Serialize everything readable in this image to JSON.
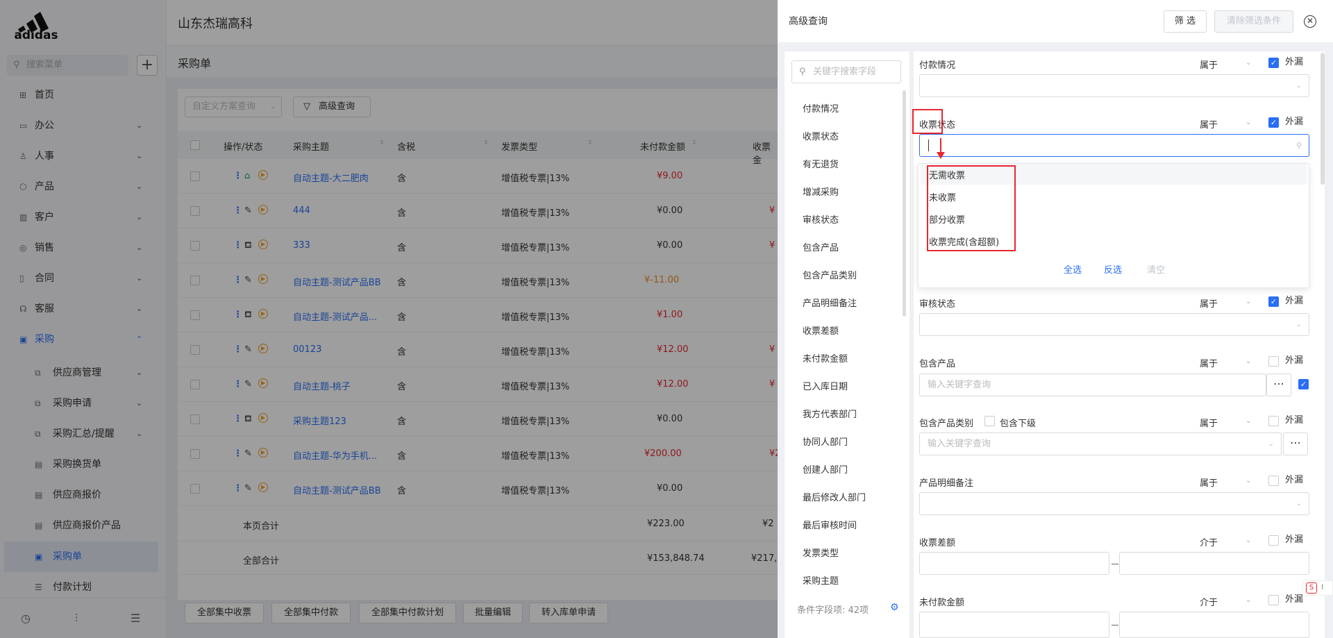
{
  "sidebar": {
    "brand": "adidas",
    "search_placeholder": "搜索菜单",
    "menu": [
      {
        "label": "首页",
        "icon": "home-icon"
      },
      {
        "label": "办公",
        "icon": "office-icon"
      },
      {
        "label": "人事",
        "icon": "people-icon"
      },
      {
        "label": "产品",
        "icon": "product-icon"
      },
      {
        "label": "客户",
        "icon": "customer-icon"
      },
      {
        "label": "销售",
        "icon": "sales-icon"
      },
      {
        "label": "合同",
        "icon": "contract-icon"
      },
      {
        "label": "客服",
        "icon": "service-icon"
      },
      {
        "label": "采购",
        "icon": "purchase-icon"
      }
    ],
    "submenu": [
      {
        "label": "供应商管理"
      },
      {
        "label": "采购申请"
      },
      {
        "label": "采购汇总/提醒"
      },
      {
        "label": "采购换货单"
      },
      {
        "label": "供应商报价"
      },
      {
        "label": "供应商报价产品"
      },
      {
        "label": "采购单"
      },
      {
        "label": "付款计划"
      }
    ]
  },
  "header": {
    "company": "山东杰瑞高科"
  },
  "page": {
    "title": "采购单",
    "scheme_placeholder": "自定义方案查询",
    "advanced_query": "高级查询"
  },
  "table": {
    "columns": [
      "操作/状态",
      "采购主题",
      "含税",
      "发票类型",
      "未付款金额",
      "收票金"
    ],
    "rows": [
      {
        "subject": "自动主题-大二肥肉",
        "tax": "含",
        "invoice": "增值税专票|13%",
        "unpaid": "¥9.00",
        "unpaid_color": "red",
        "extra": ""
      },
      {
        "subject": "444",
        "tax": "含",
        "invoice": "增值税专票|13%",
        "unpaid": "¥0.00",
        "unpaid_color": "normal",
        "extra": "¥"
      },
      {
        "subject": "333",
        "tax": "含",
        "invoice": "增值税专票|13%",
        "unpaid": "¥0.00",
        "unpaid_color": "normal",
        "extra": "¥"
      },
      {
        "subject": "自动主题-测试产品BB",
        "tax": "含",
        "invoice": "增值税专票|13%",
        "unpaid": "¥-11.00",
        "unpaid_color": "orange",
        "extra": ""
      },
      {
        "subject": "自动主题-测试产品...",
        "tax": "含",
        "invoice": "增值税专票|13%",
        "unpaid": "¥1.00",
        "unpaid_color": "red",
        "extra": ""
      },
      {
        "subject": "00123",
        "tax": "含",
        "invoice": "增值税专票|13%",
        "unpaid": "¥12.00",
        "unpaid_color": "red",
        "extra": "¥"
      },
      {
        "subject": "自动主题-桃子",
        "tax": "含",
        "invoice": "增值税专票|13%",
        "unpaid": "¥12.00",
        "unpaid_color": "red",
        "extra": "¥"
      },
      {
        "subject": "采购主题123",
        "tax": "含",
        "invoice": "增值税专票|13%",
        "unpaid": "¥0.00",
        "unpaid_color": "normal",
        "extra": ""
      },
      {
        "subject": "自动主题-华为手机...",
        "tax": "含",
        "invoice": "增值税专票|13%",
        "unpaid": "¥200.00",
        "unpaid_color": "red",
        "extra": "¥2"
      },
      {
        "subject": "自动主题-测试产品BB",
        "tax": "含",
        "invoice": "增值税专票|13%",
        "unpaid": "¥0.00",
        "unpaid_color": "normal",
        "extra": ""
      }
    ],
    "page_total_label": "本页合计",
    "page_total_value": "¥223.00",
    "page_total_extra": "¥2",
    "all_total_label": "全部合计",
    "all_total_value": "¥153,848.74",
    "all_total_extra": "¥217,9"
  },
  "footer_buttons": [
    "全部集中收票",
    "全部集中付款",
    "全部集中付款计划",
    "批量编辑",
    "转入库单申请"
  ],
  "panel": {
    "title": "高级查询",
    "filter_button": "筛 选",
    "clear_button": "清除筛选条件",
    "field_search_placeholder": "关键字搜索字段",
    "field_list": [
      "付款情况",
      "收票状态",
      "有无退货",
      "增减采购",
      "审核状态",
      "包含产品",
      "包含产品类别",
      "产品明细备注",
      "收票差额",
      "未付款金额",
      "已入库日期",
      "我方代表部门",
      "协同人部门",
      "创建人部门",
      "最后修改人部门",
      "最后审核时间",
      "发票类型",
      "采购主题"
    ],
    "field_count": "条件字段项: 42项",
    "conditions": {
      "payment": {
        "label": "付款情况",
        "op": "属于",
        "omit": "外漏"
      },
      "receipt": {
        "label": "收票状态",
        "op": "属于",
        "omit": "外漏"
      },
      "audit": {
        "label": "审核状态",
        "op": "属于",
        "omit": "外漏"
      },
      "product": {
        "label": "包含产品",
        "op": "属于",
        "omit": "外漏",
        "placeholder": "输入关键字查询"
      },
      "category": {
        "label": "包含产品类别",
        "sub": "包含下级",
        "op": "属于",
        "omit": "外漏",
        "placeholder": "输入关键字查询"
      },
      "remark": {
        "label": "产品明细备注",
        "op": "属于",
        "omit": "外漏"
      },
      "diff": {
        "label": "收票差额",
        "op": "介于",
        "omit": "外漏"
      },
      "unpaid": {
        "label": "未付款金额",
        "op": "介于",
        "omit": "外漏"
      }
    },
    "receipt_options": [
      "无需收票",
      "未收票",
      "部分收票",
      "收票完成(含超额)"
    ],
    "dropdown_actions": {
      "select_all": "全选",
      "invert": "反选",
      "clear": "清空"
    }
  }
}
